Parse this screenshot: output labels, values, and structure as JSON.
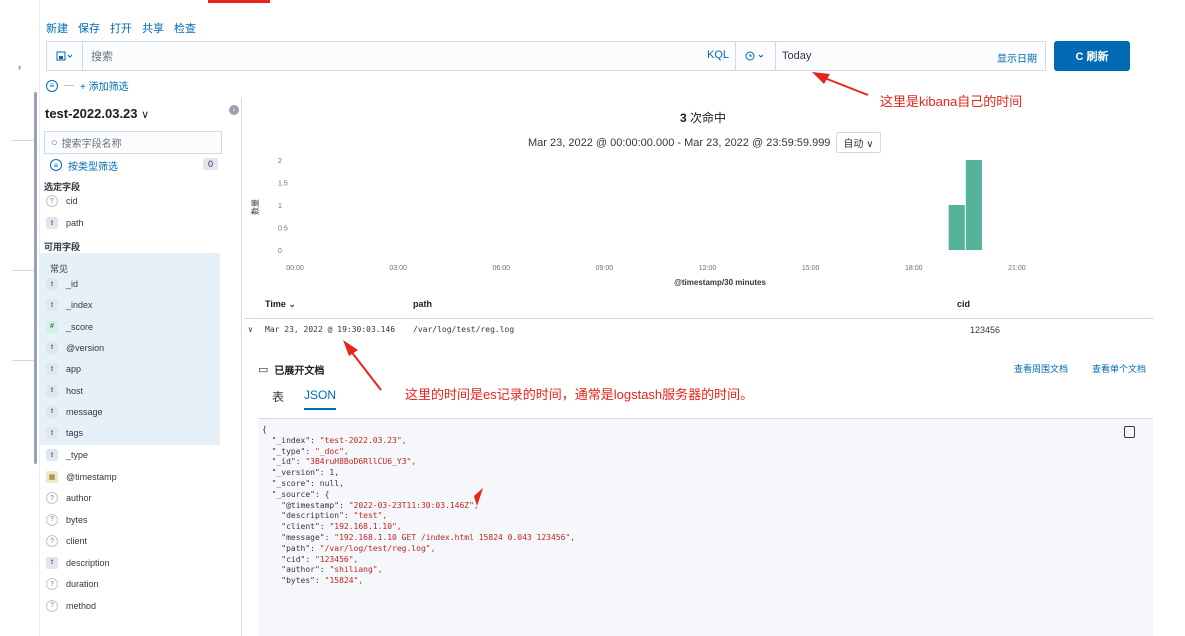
{
  "menu": [
    "新建",
    "保存",
    "打开",
    "共享",
    "检查"
  ],
  "query": {
    "placeholder": "搜索",
    "language": "KQL",
    "date": "Today",
    "show_dates": "显示日期",
    "refresh": "C 刷新"
  },
  "filter": {
    "add": "+ 添加筛选"
  },
  "sidebar": {
    "index_pattern": "test-2022.03.23",
    "search_placeholder": "搜索字段名称",
    "type_filter": "按类型筛选",
    "type_filter_count": "0",
    "selected_header": "选定字段",
    "selected": [
      {
        "type": "?",
        "name": "cid"
      },
      {
        "type": "t",
        "name": "path"
      }
    ],
    "available_header": "可用字段",
    "popular_header": "常见",
    "popular": [
      {
        "type": "t",
        "name": "_id"
      },
      {
        "type": "t",
        "name": "_index"
      },
      {
        "type": "#",
        "name": "_score"
      },
      {
        "type": "t",
        "name": "@version"
      },
      {
        "type": "t",
        "name": "app"
      },
      {
        "type": "t",
        "name": "host"
      },
      {
        "type": "t",
        "name": "message"
      },
      {
        "type": "t",
        "name": "tags"
      }
    ],
    "other": [
      {
        "type": "t",
        "name": "_type"
      },
      {
        "type": "d",
        "name": "@timestamp"
      },
      {
        "type": "?",
        "name": "author"
      },
      {
        "type": "?",
        "name": "bytes"
      },
      {
        "type": "?",
        "name": "client"
      },
      {
        "type": "t",
        "name": "description"
      },
      {
        "type": "?",
        "name": "duration"
      },
      {
        "type": "?",
        "name": "method"
      }
    ]
  },
  "main": {
    "hits_count": "3",
    "hits_label": " 次命中",
    "range": "Mar 23, 2022 @ 00:00:00.000 - Mar 23, 2022 @ 23:59:59.999",
    "interval": "自动"
  },
  "chart_data": {
    "type": "bar",
    "x": [
      "19:00",
      "19:30"
    ],
    "values": [
      1,
      2
    ],
    "xticks": [
      "00:00",
      "03:00",
      "06:00",
      "09:00",
      "12:00",
      "15:00",
      "18:00",
      "21:00"
    ],
    "yticks": [
      "0",
      "0.5",
      "1",
      "1.5",
      "2"
    ],
    "xlabel": "@timestamp/30 minutes",
    "ylabel": "数量",
    "ylim": [
      0,
      2
    ],
    "color": "#54b399"
  },
  "table": {
    "headers": [
      "Time",
      "path",
      "cid"
    ],
    "row": {
      "time": "Mar 23, 2022 @ 19:30:03.146",
      "path": "/var/log/test/reg.log",
      "cid": "123456"
    }
  },
  "doc": {
    "expanded": "已展开文档",
    "view_surrounding": "查看周围文档",
    "view_single": "查看单个文档",
    "tab_table": "表",
    "tab_json": "JSON",
    "json_lines": [
      [
        "",
        "{",
        ""
      ],
      [
        "  ",
        "\"_index\": ",
        "\"test-2022.03.23\","
      ],
      [
        "  ",
        "\"_type\": ",
        "\"_doc\","
      ],
      [
        "  ",
        "\"_id\": ",
        "\"3B4ruH8BoD6RllCU6_Y3\","
      ],
      [
        "  ",
        "\"_version\": 1,",
        ""
      ],
      [
        "  ",
        "\"_score\": null,",
        ""
      ],
      [
        "  ",
        "\"_source\": {",
        ""
      ],
      [
        "    ",
        "\"@timestamp\": ",
        "\"2022-03-23T11:30:03.146Z\","
      ],
      [
        "    ",
        "\"description\": ",
        "\"test\","
      ],
      [
        "    ",
        "\"client\": ",
        "\"192.168.1.10\","
      ],
      [
        "    ",
        "\"message\": ",
        "\"192.168.1.10 GET /index.html 15824 0.043 123456\","
      ],
      [
        "    ",
        "\"path\": ",
        "\"/var/log/test/reg.log\","
      ],
      [
        "    ",
        "\"cid\": ",
        "\"123456\","
      ],
      [
        "    ",
        "\"author\": ",
        "\"shiliang\","
      ],
      [
        "    ",
        "\"bytes\": ",
        "\"15824\","
      ]
    ]
  },
  "annotations": {
    "kibana_time": "这里是kibana自己的时间",
    "es_time": "这里的时间是es记录的时间，通常是logstash服务器的时间。"
  }
}
